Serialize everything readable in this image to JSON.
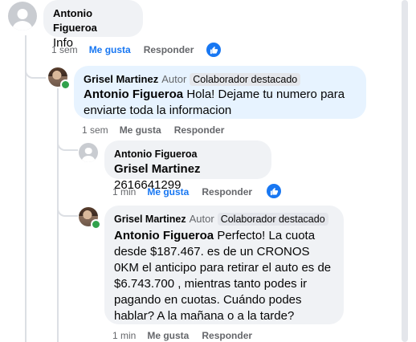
{
  "comments": [
    {
      "author": "Antonio Figueroa",
      "text": "Info",
      "meta": {
        "time": "1 sem",
        "like": "Me gusta",
        "reply": "Responder"
      }
    },
    {
      "author": "Grisel Martinez",
      "author_badge": "Autor",
      "fan_badge": "Colaborador destacado",
      "mention": "Antonio Figueroa",
      "text": " Hola! Dejame tu numero para enviarte toda la informacion",
      "meta": {
        "time": "1 sem",
        "like": "Me gusta",
        "reply": "Responder"
      }
    },
    {
      "author": "Antonio Figueroa",
      "mention": "Grisel Martinez",
      "text": " 2616641299",
      "meta": {
        "time": "1 min",
        "like": "Me gusta",
        "reply": "Responder"
      }
    },
    {
      "author": "Grisel Martinez",
      "author_badge": "Autor",
      "fan_badge": "Colaborador destacado",
      "mention": "Antonio Figueroa",
      "text": " Perfecto! La cuota desde $187.467. es de un CRONOS 0KM el anticipo para retirar el auto es de $6.743.700 , mientras tanto podes ir pagando en cuotas. Cuándo podes hablar? A la mañana o a la tarde?",
      "meta": {
        "time": "1 min",
        "like": "Me gusta",
        "reply": "Responder"
      }
    }
  ],
  "colors": {
    "accent": "#1877f2",
    "bubble": "#f0f2f5",
    "highlight": "#e7f3ff",
    "meta": "#65676b"
  },
  "icons": {
    "like": "thumbs-up-icon",
    "avatar_default": "default-avatar-icon"
  }
}
